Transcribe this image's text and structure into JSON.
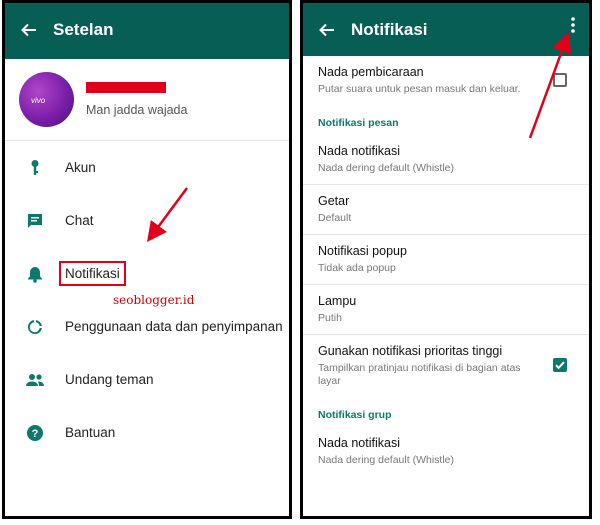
{
  "left": {
    "title": "Setelan",
    "status": "Man jadda wajada",
    "avatar_brand": "vivo",
    "items": [
      {
        "label": "Akun",
        "icon": "key-icon"
      },
      {
        "label": "Chat",
        "icon": "chat-icon"
      },
      {
        "label": "Notifikasi",
        "icon": "bell-icon"
      },
      {
        "label": "Penggunaan data dan penyimpanan",
        "icon": "data-usage-icon"
      },
      {
        "label": "Undang teman",
        "icon": "people-icon"
      },
      {
        "label": "Bantuan",
        "icon": "help-icon"
      }
    ],
    "watermark": "seoblogger.id"
  },
  "right": {
    "title": "Notifikasi",
    "conversation_tones": {
      "title": "Nada pembicaraan",
      "subtitle": "Putar suara untuk pesan masuk dan keluar.",
      "checked": false
    },
    "section_message": "Notifikasi pesan",
    "message_items": [
      {
        "title": "Nada notifikasi",
        "subtitle": "Nada dering default (Whistle)"
      },
      {
        "title": "Getar",
        "subtitle": "Default"
      },
      {
        "title": "Notifikasi popup",
        "subtitle": "Tidak ada popup"
      },
      {
        "title": "Lampu",
        "subtitle": "Putih"
      }
    ],
    "priority": {
      "title": "Gunakan notifikasi prioritas tinggi",
      "subtitle": "Tampilkan pratinjau notifikasi di bagian atas layar",
      "checked": true
    },
    "section_group": "Notifikasi grup",
    "group_items": [
      {
        "title": "Nada notifikasi",
        "subtitle": "Nada dering default (Whistle)"
      }
    ]
  },
  "colors": {
    "appbar": "#075e54",
    "accent": "#0b7a6c",
    "highlight": "#e0001a"
  }
}
